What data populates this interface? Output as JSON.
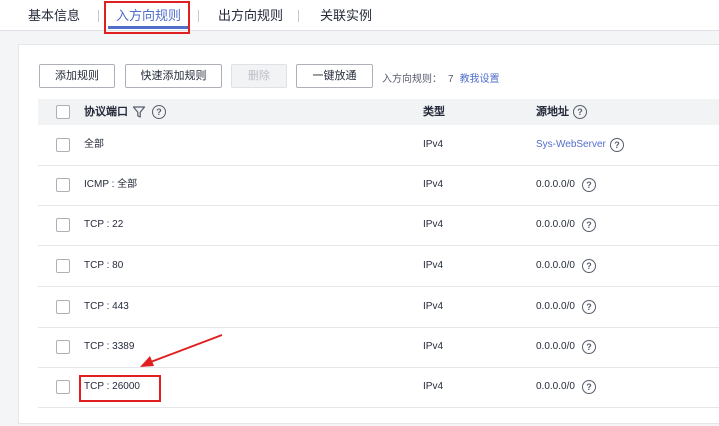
{
  "tabs": [
    {
      "label": "基本信息"
    },
    {
      "label": "入方向规则"
    },
    {
      "label": "出方向规则"
    },
    {
      "label": "关联实例"
    }
  ],
  "toolbar": {
    "add_rule": "添加规则",
    "quick_add_rule": "快速添加规则",
    "delete": "删除",
    "one_click_allow": "一键放通",
    "inbound_rules_label": "入方向规则：",
    "inbound_rules_count": "7",
    "help_link": "教我设置"
  },
  "table": {
    "headers": {
      "protocol_port": "协议端口",
      "type": "类型",
      "source": "源地址"
    },
    "rows": [
      {
        "protocol_port": "全部",
        "type": "IPv4",
        "source": "Sys-WebServer"
      },
      {
        "protocol_port": "ICMP : 全部",
        "type": "IPv4",
        "source": "0.0.0.0/0"
      },
      {
        "protocol_port": "TCP : 22",
        "type": "IPv4",
        "source": "0.0.0.0/0"
      },
      {
        "protocol_port": "TCP : 80",
        "type": "IPv4",
        "source": "0.0.0.0/0"
      },
      {
        "protocol_port": "TCP : 443",
        "type": "IPv4",
        "source": "0.0.0.0/0"
      },
      {
        "protocol_port": "TCP : 3389",
        "type": "IPv4",
        "source": "0.0.0.0/0"
      },
      {
        "protocol_port": "TCP : 26000",
        "type": "IPv4",
        "source": "0.0.0.0/0"
      }
    ]
  },
  "colors": {
    "accent": "#526ecc",
    "annotation": "#e02020"
  },
  "icons": {
    "filter": "filter-icon",
    "help": "help-circle-icon"
  }
}
